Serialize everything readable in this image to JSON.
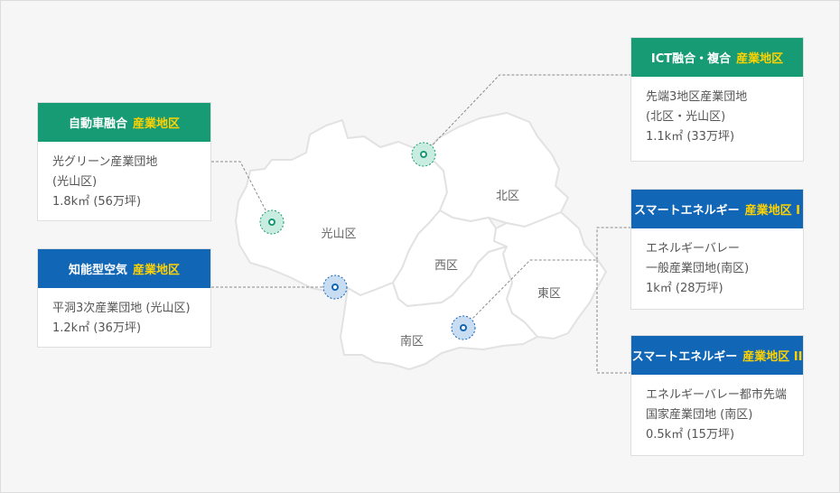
{
  "map": {
    "districts": [
      {
        "id": "gwangsan",
        "label": "光山区"
      },
      {
        "id": "buk",
        "label": "北区"
      },
      {
        "id": "seo",
        "label": "西区"
      },
      {
        "id": "nam",
        "label": "南区"
      },
      {
        "id": "dong",
        "label": "東区"
      }
    ]
  },
  "cards": {
    "auto": {
      "title": "自動車融合",
      "highlight": "産業地区",
      "lines": [
        "光グリーン産業団地",
        "(光山区)",
        "1.8k㎡ (56万坪)"
      ]
    },
    "knowledge": {
      "title": "知能型空気",
      "highlight": "産業地区",
      "lines": [
        "平洞3次産業団地 (光山区)",
        "1.2k㎡ (36万坪)"
      ]
    },
    "ict": {
      "title": "ICT融合・複合",
      "highlight": "産業地区",
      "lines": [
        "先端3地区産業団地",
        "(北区・光山区)",
        "1.1k㎡ (33万坪)"
      ]
    },
    "energy1": {
      "title": "スマートエネルギー",
      "highlight": "産業地区 I",
      "lines": [
        "エネルギーバレー",
        "一般産業団地(南区)",
        "1k㎡ (28万坪)"
      ]
    },
    "energy2": {
      "title": "スマートエネルギー",
      "highlight": "産業地区 II",
      "lines": [
        "エネルギーバレー都市先端",
        "国家産業団地 (南区)",
        "0.5k㎡ (15万坪)"
      ]
    }
  },
  "colors": {
    "green": "#169b74",
    "blue": "#1166b6",
    "highlight": "#ffd200",
    "marker_green_fill": "#c9ece0",
    "marker_blue_fill": "#c8dcf2"
  }
}
